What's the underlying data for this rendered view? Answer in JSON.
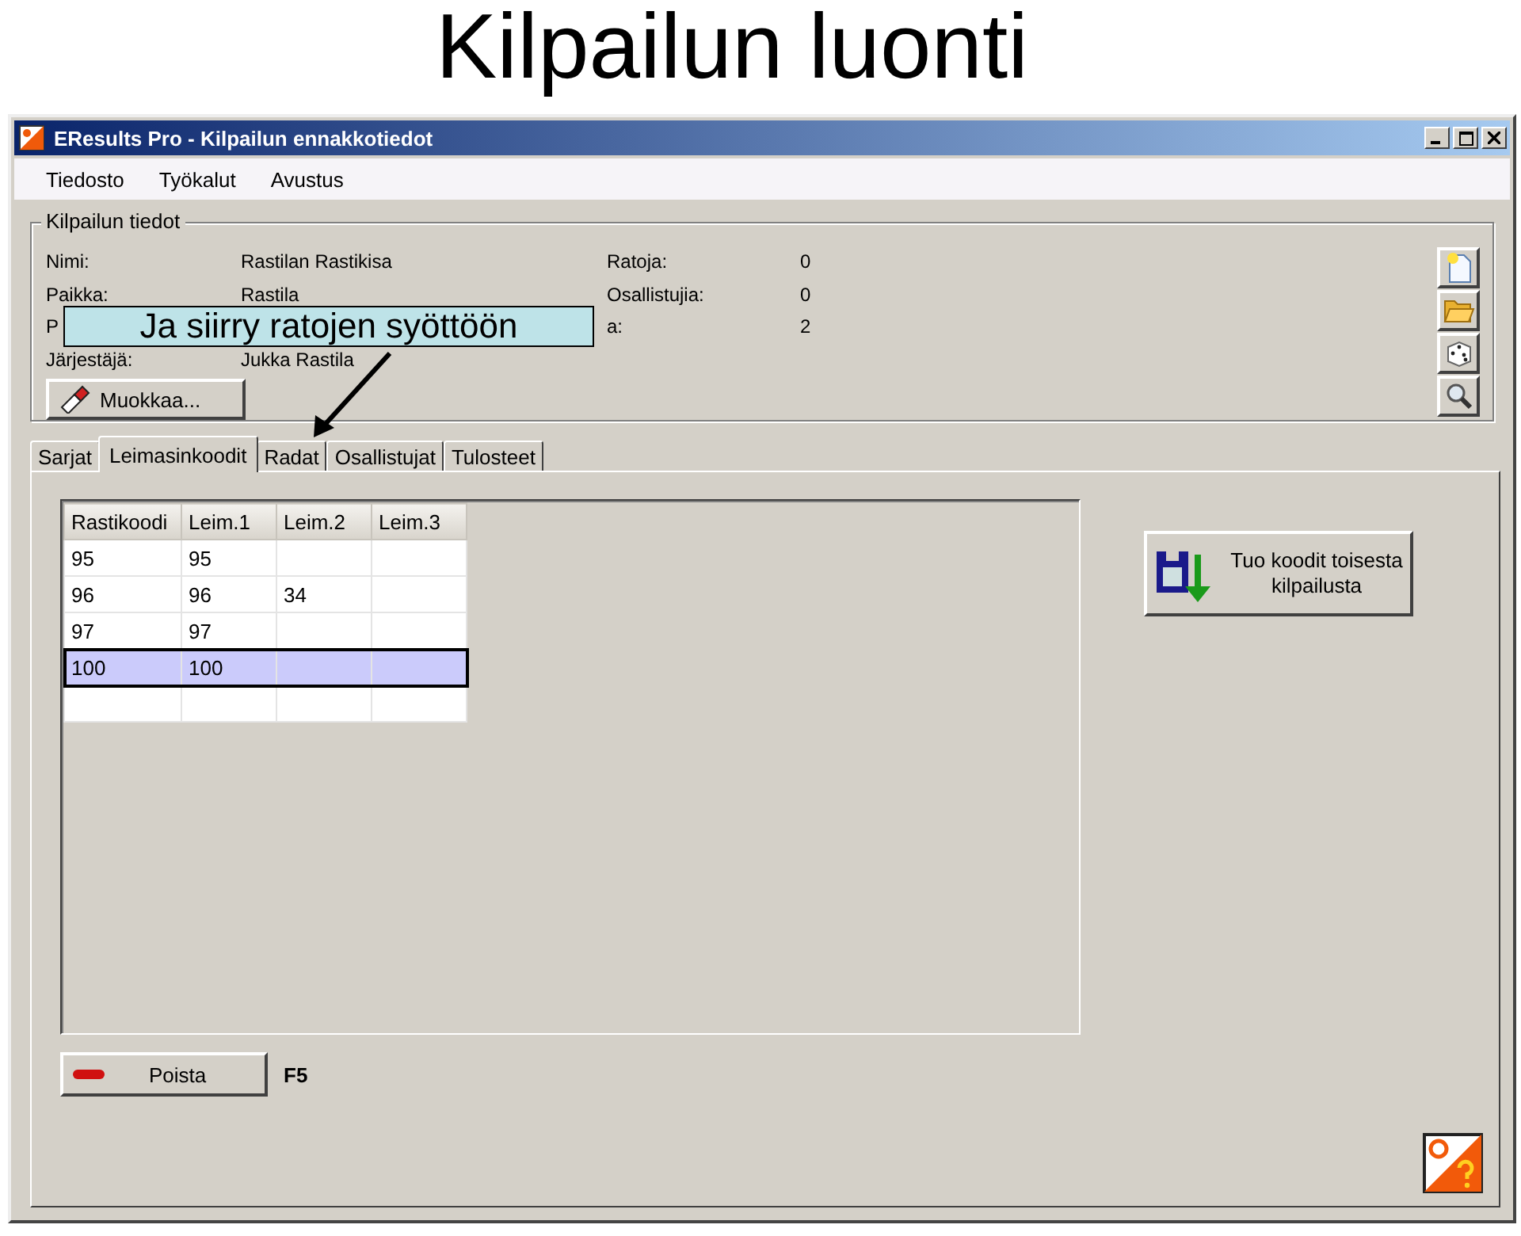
{
  "slide_title": "Kilpailun luonti",
  "window": {
    "title": "EResults Pro - Kilpailun ennakkotiedot"
  },
  "menu": [
    {
      "label": "Tiedosto"
    },
    {
      "label": "Työkalut"
    },
    {
      "label": "Avustus"
    }
  ],
  "info_group": {
    "title": "Kilpailun tiedot",
    "left_fields": [
      {
        "label": "Nimi:",
        "value": "Rastilan Rastikisa"
      },
      {
        "label": "Paikka:",
        "value": "Rastila"
      },
      {
        "label": "P"
      },
      {
        "label": "Järjestäjä:",
        "value": "Jukka Rastila"
      }
    ],
    "right_fields": [
      {
        "label": "Ratoja:",
        "value": "0"
      },
      {
        "label": "Osallistujia:",
        "value": "0"
      },
      {
        "label": "a:",
        "value": "2"
      }
    ],
    "edit_button": "Muokkaa..."
  },
  "tabs": [
    {
      "label": "Sarjat",
      "selected": false
    },
    {
      "label": "Leimasinkoodit",
      "selected": true
    },
    {
      "label": "Radat",
      "selected": false
    },
    {
      "label": "Osallistujat",
      "selected": false
    },
    {
      "label": "Tulosteet",
      "selected": false
    }
  ],
  "table": {
    "columns": [
      "Rastikoodi",
      "Leim.1",
      "Leim.2",
      "Leim.3"
    ],
    "rows": [
      {
        "cells": [
          "95",
          "95"
        ],
        "selected": false
      },
      {
        "cells": [
          "96",
          "96",
          "34"
        ],
        "selected": false
      },
      {
        "cells": [
          "97",
          "97"
        ],
        "selected": false
      },
      {
        "cells": [
          "100",
          "100"
        ],
        "selected": true
      }
    ]
  },
  "import_button": "Tuo koodit toisesta kilpailusta",
  "delete_button": "Poista",
  "delete_shortcut": "F5",
  "callout": "Ja siirry ratojen syöttöön"
}
